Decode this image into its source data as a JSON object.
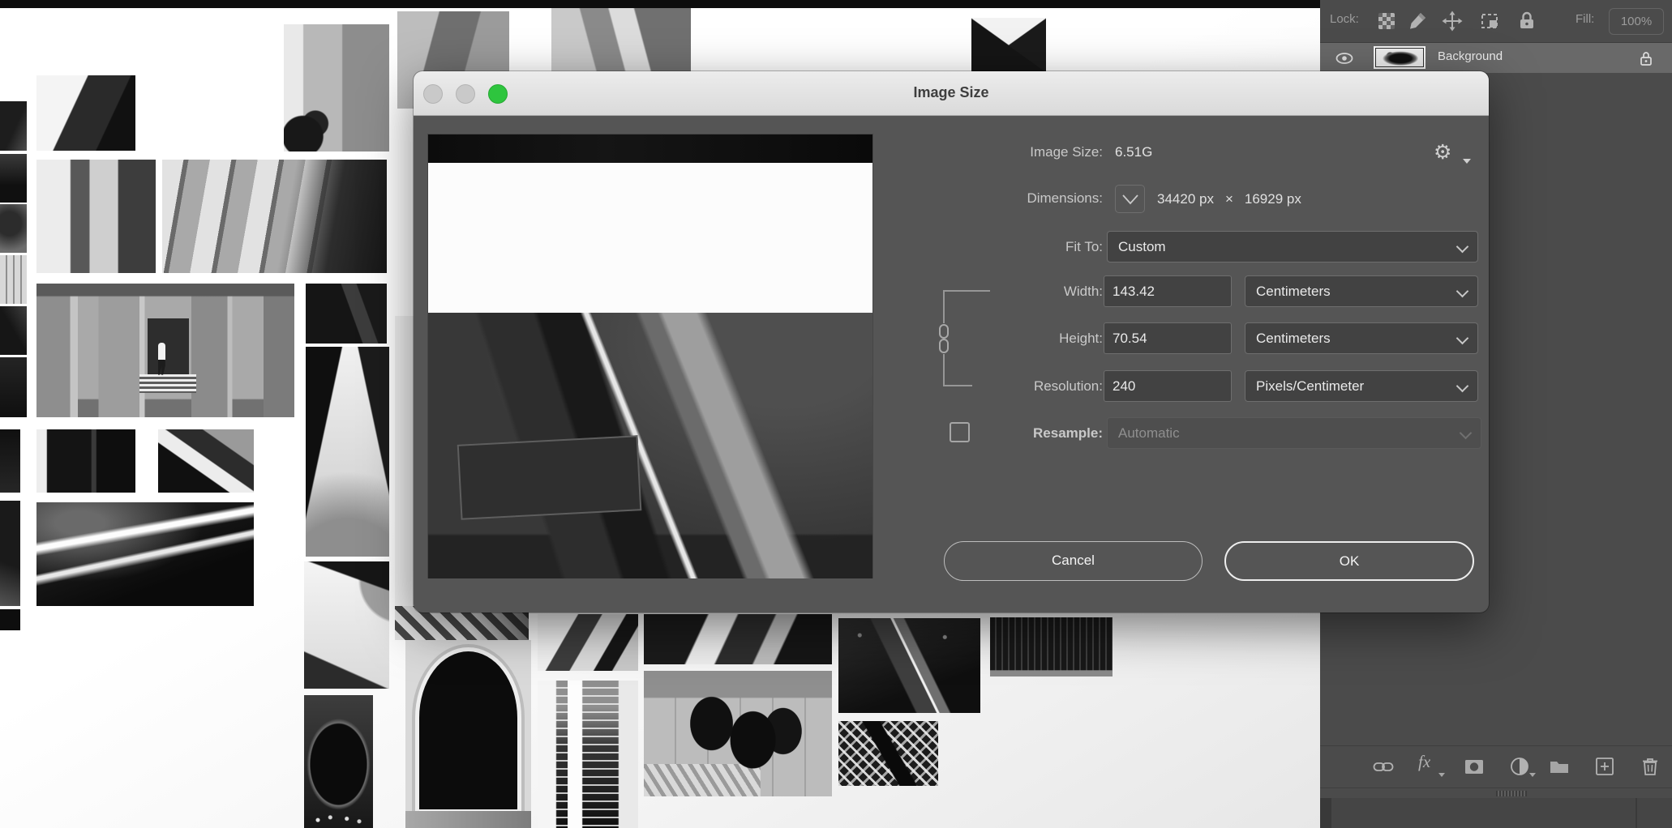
{
  "layers_panel": {
    "lock_label": "Lock:",
    "fill_label": "Fill:",
    "fill_value": "100%",
    "layer_name": "Background"
  },
  "dialog": {
    "title": "Image Size",
    "image_size_label": "Image Size:",
    "image_size_value": "6.51G",
    "dimensions_label": "Dimensions:",
    "dimensions_width": "34420 px",
    "dimensions_sep": "×",
    "dimensions_height": "16929 px",
    "fit_to_label": "Fit To:",
    "fit_to_value": "Custom",
    "width_label": "Width:",
    "width_value": "143.42",
    "width_unit": "Centimeters",
    "height_label": "Height:",
    "height_value": "70.54",
    "height_unit": "Centimeters",
    "resolution_label": "Resolution:",
    "resolution_value": "240",
    "resolution_unit": "Pixels/Centimeter",
    "resample_label": "Resample:",
    "resample_value": "Automatic",
    "cancel_label": "Cancel",
    "ok_label": "OK"
  },
  "colors": {
    "accent_green": "#2ec53e",
    "dialog_bg": "#555555",
    "panel_bg": "#4b4b4b",
    "titlebar_bg": "#e9e9e9"
  }
}
